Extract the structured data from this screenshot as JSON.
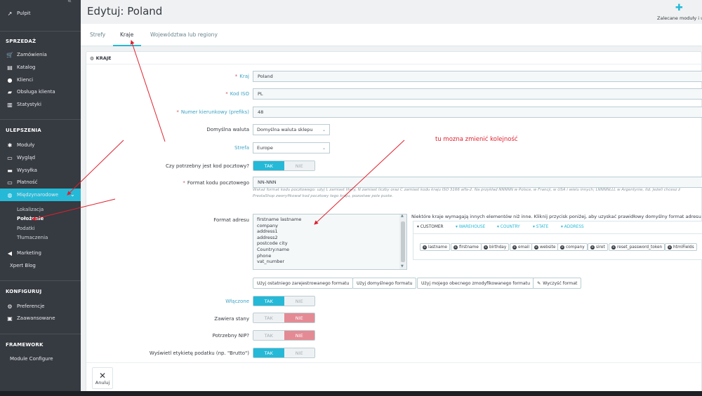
{
  "sidebar": {
    "dashboard": "Pulpit",
    "sections": {
      "sales": "SPRZEDAŻ",
      "improve": "ULEPSZENIA",
      "configure": "KONFIGURUJ",
      "framework": "FRAMEWORK"
    },
    "sales_items": [
      "Zamówienia",
      "Katalog",
      "Klienci",
      "Obsługa klienta",
      "Statystyki"
    ],
    "improve_items": [
      "Moduły",
      "Wygląd",
      "Wysyłka",
      "Płatność",
      "Międzynarodowe"
    ],
    "international_sub": [
      "Lokalizacja",
      "Położenie",
      "Podatki",
      "Tłumaczenia"
    ],
    "after_items": [
      "Marketing",
      "Xpert Blog"
    ],
    "configure_items": [
      "Preferencje",
      "Zaawansowane"
    ],
    "framework_items": [
      "Module Configure"
    ]
  },
  "header": {
    "title": "Edytuj: Poland",
    "recommended": "Zalecane moduły i us"
  },
  "tabs": [
    "Strefy",
    "Kraje",
    "Województwa lub regiony"
  ],
  "panel": {
    "heading": "KRAJE",
    "labels": {
      "country": "Kraj",
      "iso": "Kod ISO",
      "prefix": "Numer kierunkowy (prefiks)",
      "currency": "Domyślna waluta",
      "zone": "Strefa",
      "need_zip": "Czy potrzebny jest kod pocztowy?",
      "zip_format": "Format kodu pocztowego",
      "address_format": "Format adresu",
      "active": "Włączone",
      "contains_states": "Zawiera stany",
      "need_nip": "Potrzebny NIP?",
      "display_tax_label": "Wyświetl etykietę podatku (np. \"Brutto\")"
    },
    "values": {
      "country": "Poland",
      "iso": "PL",
      "prefix": "48",
      "currency": "Domyślna waluta sklepu",
      "zone": "Europe",
      "zip_format": "NN-NNN"
    },
    "switch": {
      "yes": "TAK",
      "no": "NIE"
    },
    "zip_help_1": "Wskaż format kodu pocztowego: użyj L zamiast litery, N zamiast liczby oraz C zamiast kodu kraju ISO 3166 alfa-2. Na przykład NNNNN w Polsce, w Francji, w USA i wielu innych; LNNNNLLL w Argentynie, itd. Jeżeli chcesz ż",
    "zip_help_2": "PrestaShop zweryfikował kod pocztowy tego kraju, pozostaw pole puste.",
    "address_lines": [
      "firstname lastname",
      "company",
      "address1",
      "address2",
      "postcode city",
      "Country:name",
      "phone",
      "vat_number"
    ],
    "format_note": "Niektóre kraje wymagają innych elementów niż inne. Kliknij przycisk poniżej, aby uzyskać prawidłowy domyślny format adresu dla tego",
    "format_tabs": [
      "CUSTOMER",
      "WAREHOUSE",
      "COUNTRY",
      "STATE",
      "ADDRESS"
    ],
    "chips": [
      "lastname",
      "firstname",
      "birthday",
      "email",
      "website",
      "company",
      "siret",
      "reset_password_token",
      "htmlFields"
    ],
    "buttons": [
      "Użyj ostatniego zarejestrowanego formatu",
      "Użyj domyślnego formatu",
      "Użyj mojego obecnego zmodyfikowanego formatu",
      "Wyczyść format"
    ],
    "cancel": "Anuluj"
  },
  "annotation": "tu mozna zmienić kolejność",
  "colors": {
    "accent": "#25b9d7",
    "sidebar": "#363a41",
    "annotation": "#e0202e",
    "no_active": "#e48a94"
  }
}
